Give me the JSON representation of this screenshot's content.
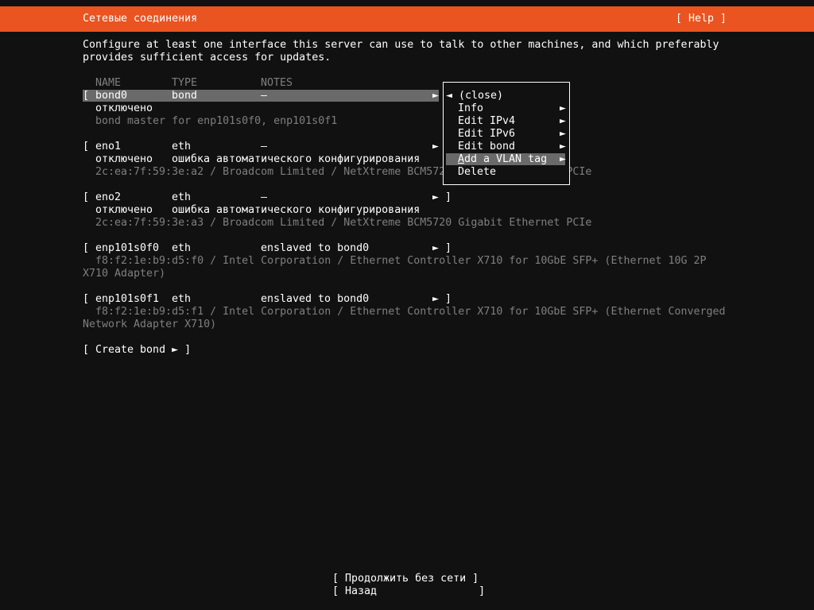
{
  "header": {
    "title": "Сетевые соединения",
    "help": "[ Help ]"
  },
  "intro": {
    "line1": "Configure at least one interface this server can use to talk to other machines, and which preferably",
    "line2": "provides sufficient access for updates."
  },
  "columns": {
    "name": "NAME",
    "type": "TYPE",
    "notes": "NOTES"
  },
  "interfaces": [
    {
      "open": "[",
      "name": "bond0",
      "type": "bond",
      "notes": "–",
      "arrow": "►",
      "close": "]",
      "status": "отключено",
      "status_detail": "",
      "info": "bond master for enp101s0f0, enp101s0f1"
    },
    {
      "open": "[",
      "name": "eno1",
      "type": "eth",
      "notes": "–",
      "arrow": "►",
      "close": "]",
      "status": "отключено",
      "status_detail": "ошибка автоматического конфигурирования",
      "info": "2c:ea:7f:59:3e:a2 / Broadcom Limited / NetXtreme BCM5720 Gigabit Ethernet PCIe"
    },
    {
      "open": "[",
      "name": "eno2",
      "type": "eth",
      "notes": "–",
      "arrow": "►",
      "close": "]",
      "status": "отключено",
      "status_detail": "ошибка автоматического конфигурирования",
      "info": "2c:ea:7f:59:3e:a3 / Broadcom Limited / NetXtreme BCM5720 Gigabit Ethernet PCIe"
    },
    {
      "open": "[",
      "name": "enp101s0f0",
      "type": "eth",
      "notes": "enslaved to bond0",
      "arrow": "►",
      "close": "]",
      "info1": "f8:f2:1e:b9:d5:f0 / Intel Corporation / Ethernet Controller X710 for 10GbE SFP+ (Ethernet 10G 2P",
      "info2": "X710 Adapter)"
    },
    {
      "open": "[",
      "name": "enp101s0f1",
      "type": "eth",
      "notes": "enslaved to bond0",
      "arrow": "►",
      "close": "]",
      "info1": "f8:f2:1e:b9:d5:f1 / Intel Corporation / Ethernet Controller X710 for 10GbE SFP+ (Ethernet Converged",
      "info2": "Network Adapter X710)"
    }
  ],
  "create_bond": "[ Create bond ► ]",
  "menu": {
    "close": {
      "arrow": "◄",
      "label": "(close)"
    },
    "items": [
      {
        "label": "Info",
        "arrow": "►"
      },
      {
        "label": "Edit IPv4",
        "arrow": "►"
      },
      {
        "label": "Edit IPv6",
        "arrow": "►"
      },
      {
        "label": "Edit bond",
        "arrow": "►"
      },
      {
        "label_first": "A",
        "label_rest": "dd a VLAN tag",
        "arrow": "►"
      },
      {
        "label": "Delete"
      }
    ]
  },
  "footer": {
    "continue": "[ Продолжить без сети ]",
    "back": "[ Назад                ]"
  },
  "colors": {
    "accent": "#e95420",
    "highlight": "#6a6a6a",
    "background": "#111111"
  }
}
